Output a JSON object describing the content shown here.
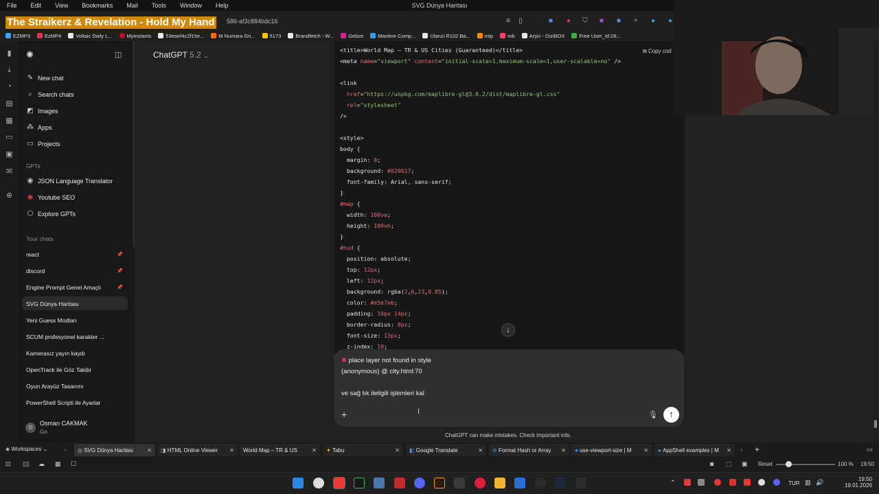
{
  "menubar": {
    "items": [
      "File",
      "Edit",
      "View",
      "Bookmarks",
      "Mail",
      "Tools",
      "Window",
      "Help"
    ],
    "window_title": "SVG Dünya Haritası"
  },
  "overlay": {
    "now_playing": "The Straikerz & Revelation - Hold My Hand"
  },
  "address": {
    "url_fragment": "586-af3c884bdc16"
  },
  "bookmarks": [
    {
      "label": "EZMP3",
      "color": "#3aa1ff"
    },
    {
      "label": "EzMP4",
      "color": "#e0334e"
    },
    {
      "label": "Voltaic Daily L...",
      "color": "#e8e8e8"
    },
    {
      "label": "Myinstants",
      "color": "#c0102e"
    },
    {
      "label": "53eaef4c2f15e...",
      "color": "#e8e8e8"
    },
    {
      "label": "M Numara Gri...",
      "color": "#ff6a00"
    },
    {
      "label": "5173",
      "color": "#f5c400"
    },
    {
      "label": "Brandfetch - W...",
      "color": "#e8e8e8"
    },
    {
      "label": "Gebze",
      "color": "#d6249f"
    },
    {
      "label": "Mantine Comp...",
      "color": "#339af0"
    },
    {
      "label": "Ulanzi R102 Ba...",
      "color": "#e8e8e8"
    },
    {
      "label": "mtp",
      "color": "#ff8a00"
    },
    {
      "label": "mb",
      "color": "#ff3b6a"
    },
    {
      "label": "Arşiv - DiziBOX",
      "color": "#e8e8e8"
    },
    {
      "label": "Free User_Id:28...",
      "color": "#3cb043"
    }
  ],
  "sidebar": {
    "actions": [
      {
        "label": "New chat",
        "icon": "edit-icon"
      },
      {
        "label": "Search chats",
        "icon": "search-icon"
      },
      {
        "label": "Images",
        "icon": "image-icon"
      },
      {
        "label": "Apps",
        "icon": "apps-icon"
      },
      {
        "label": "Projects",
        "icon": "folder-icon"
      }
    ],
    "gpts_heading": "GPTs",
    "gpts": [
      {
        "label": "JSON Language Translator"
      },
      {
        "label": "Youtube SEO"
      },
      {
        "label": "Explore GPTs"
      }
    ],
    "chats_heading": "Your chats",
    "chats": [
      {
        "label": "react",
        "pinned": true
      },
      {
        "label": "discord",
        "pinned": true
      },
      {
        "label": "Engine Prompt Genel Amaçlı",
        "pinned": true
      },
      {
        "label": "SVG Dünya Haritası",
        "pinned": false
      },
      {
        "label": "Yeni Guess Modları",
        "pinned": false
      },
      {
        "label": "SCUM profesyonel karakter ...",
        "pinned": false
      },
      {
        "label": "Kamerasız yayın kaydı",
        "pinned": false
      },
      {
        "label": "OpenTrack ile Göz Takibi",
        "pinned": false
      },
      {
        "label": "Oyun Arayüz Tasarımı",
        "pinned": false
      },
      {
        "label": "PowerShell Scripti ile Ayarlar",
        "pinned": false
      }
    ],
    "user": {
      "name": "Osman CAKMAK",
      "plan": "Go",
      "initial": "O"
    }
  },
  "header": {
    "model": "ChatGPT",
    "version": "5.2"
  },
  "code": {
    "copy_label": "Copy cod",
    "lines": [
      {
        "t": "<title>World Map – TR & US Cities (Guaranteed)</title>"
      },
      {
        "t": "<meta name=\"viewport\" content=\"initial-scale=1,maximum-scale=1,user-scalable=no\" />"
      },
      {
        "t": ""
      },
      {
        "t": "<link"
      },
      {
        "t": "  href=\"https://unpkg.com/maplibre-gl@3.6.2/dist/maplibre-gl.css\""
      },
      {
        "t": "  rel=\"stylesheet\""
      },
      {
        "t": "/>"
      },
      {
        "t": ""
      },
      {
        "t": "<style>"
      },
      {
        "t": "body {"
      },
      {
        "t": "  margin: 0;"
      },
      {
        "t": "  background: #020617;"
      },
      {
        "t": "  font-family: Arial, sans-serif;"
      },
      {
        "t": "}"
      },
      {
        "t": "#map {"
      },
      {
        "t": "  width: 100vw;"
      },
      {
        "t": "  height: 100vh;"
      },
      {
        "t": "}"
      },
      {
        "t": "#hud {"
      },
      {
        "t": "  position: absolute;"
      },
      {
        "t": "  top: 12px;"
      },
      {
        "t": "  left: 12px;"
      },
      {
        "t": "  background: rgba(2,6,23,0.85);"
      },
      {
        "t": "  color: #e5e7eb;"
      },
      {
        "t": "  padding: 10px 14px;"
      },
      {
        "t": "  border-radius: 8px;"
      },
      {
        "t": "  font-size: 13px;"
      },
      {
        "t": "  z-index: 10;"
      }
    ]
  },
  "composer": {
    "error_line": "place layer not found in style",
    "trace_line": "(anonymous)    @ city.html:70",
    "message_line": "ve sağ tık ileilgili işlemleri kal"
  },
  "disclaimer": "ChatGPT can make mistakes. Check important info.",
  "tabs": {
    "workspaces": "Workspaces",
    "items": [
      {
        "label": "SVG Dünya Haritası",
        "active": true
      },
      {
        "label": "HTML Online Viewer",
        "active": false
      },
      {
        "label": "World Map – TR & US",
        "active": false
      },
      {
        "label": "Tabu",
        "active": false
      },
      {
        "label": "Google Translate",
        "active": false
      },
      {
        "label": "Format Hash or Array",
        "active": false
      },
      {
        "label": "use-viewport-size | M",
        "active": false
      },
      {
        "label": "AppShell examples | M",
        "active": false
      }
    ]
  },
  "statusbar": {
    "reset": "Reset",
    "zoom": "100 %",
    "time": "19:50"
  },
  "taskbar": {
    "lang": "TUR",
    "time": "19:50",
    "date": "19.01.2026"
  }
}
